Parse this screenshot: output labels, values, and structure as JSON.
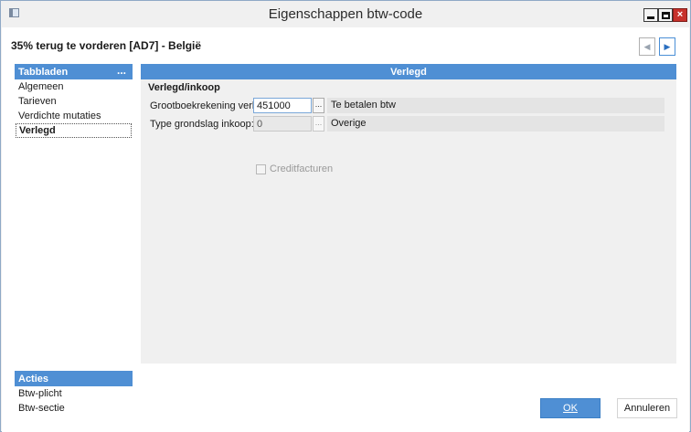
{
  "window": {
    "title": "Eigenschappen btw-code",
    "close_glyph": "×"
  },
  "record": {
    "title": "35% terug te vorderen [AD7] - België",
    "prev_glyph": "◀",
    "next_glyph": "▶"
  },
  "tabs_panel": {
    "header": "Tabbladen",
    "more": "...",
    "items": [
      "Algemeen",
      "Tarieven",
      "Verdichte mutaties",
      "Verlegd"
    ],
    "active_index": 3
  },
  "actions_panel": {
    "header": "Acties",
    "items": [
      "Btw-plicht",
      "Btw-sectie"
    ]
  },
  "main": {
    "header": "Verlegd",
    "section": "Verlegd/inkoop",
    "fields": [
      {
        "label": "Grootboekrekening verlegd:",
        "value": "451000",
        "lookup": "...",
        "description": "Te betalen btw"
      },
      {
        "label": "Type grondslag inkoop:",
        "value": "0",
        "lookup": "...",
        "description": "Overige"
      }
    ],
    "checkbox": {
      "label": "Creditfacturen",
      "checked": false,
      "enabled": false
    }
  },
  "buttons": {
    "ok": "OK",
    "cancel": "Annuleren"
  },
  "colors": {
    "accent": "#4f8fd4",
    "close": "#c7312b"
  },
  "icons": [
    "app-icon",
    "minimize-icon",
    "maximize-icon",
    "close-icon",
    "chevron-left-icon",
    "chevron-right-icon"
  ]
}
